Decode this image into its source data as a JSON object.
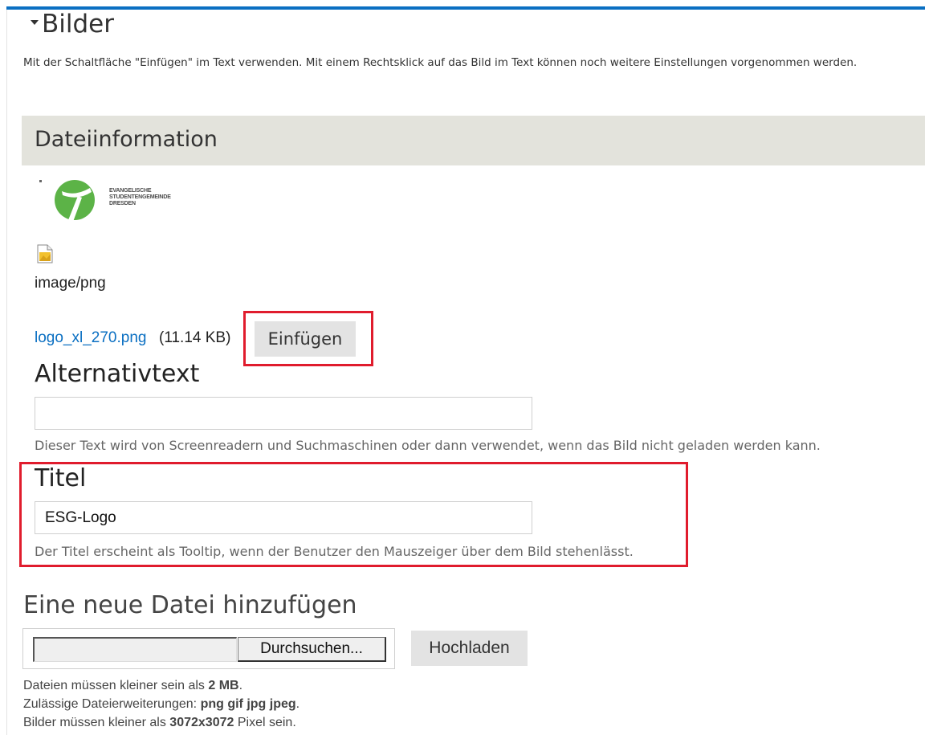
{
  "section": {
    "title": "Bilder",
    "caret_icon": "caret-down-icon"
  },
  "description": "Mit der Schaltfläche \"Einfügen\" im Text verwenden. Mit einem Rechtsklick auf das Bild im Text können noch weitere Einstellungen vorgenommen werden.",
  "file_info": {
    "heading": "Dateiinformation",
    "logo_text": "EVANGELISCHE\nSTUDENTENGEMEINDE\nDRESDEN",
    "mime": "image/png",
    "filename": "logo_xl_270.png",
    "filesize": "(11.14 KB)",
    "insert_label": "Einfügen",
    "logo_color": "#5cb347"
  },
  "alt": {
    "label": "Alternativtext",
    "value": "",
    "help": "Dieser Text wird von Screenreadern und Suchmaschinen oder dann verwendet, wenn das Bild nicht geladen werden kann."
  },
  "title_field": {
    "label": "Titel",
    "value": "ESG-Logo",
    "help": "Der Titel erscheint als Tooltip, wenn der Benutzer den Mauszeiger über dem Bild stehenlässt."
  },
  "upload": {
    "heading": "Eine neue Datei hinzufügen",
    "browse_label": "Durchsuchen...",
    "upload_label": "Hochladen",
    "size_prefix": "Dateien müssen kleiner sein als ",
    "size_value": "2 MB",
    "size_suffix": ".",
    "ext_prefix": "Zulässige Dateierweiterungen: ",
    "ext_value": "png gif jpg jpeg",
    "ext_suffix": ".",
    "dim_prefix": "Bilder müssen kleiner als ",
    "dim_value": "3072x3072",
    "dim_suffix": " Pixel sein."
  },
  "colors": {
    "accent": "#0a6fc2",
    "highlight": "#e01c2d",
    "panel": "#e3e3dc"
  }
}
